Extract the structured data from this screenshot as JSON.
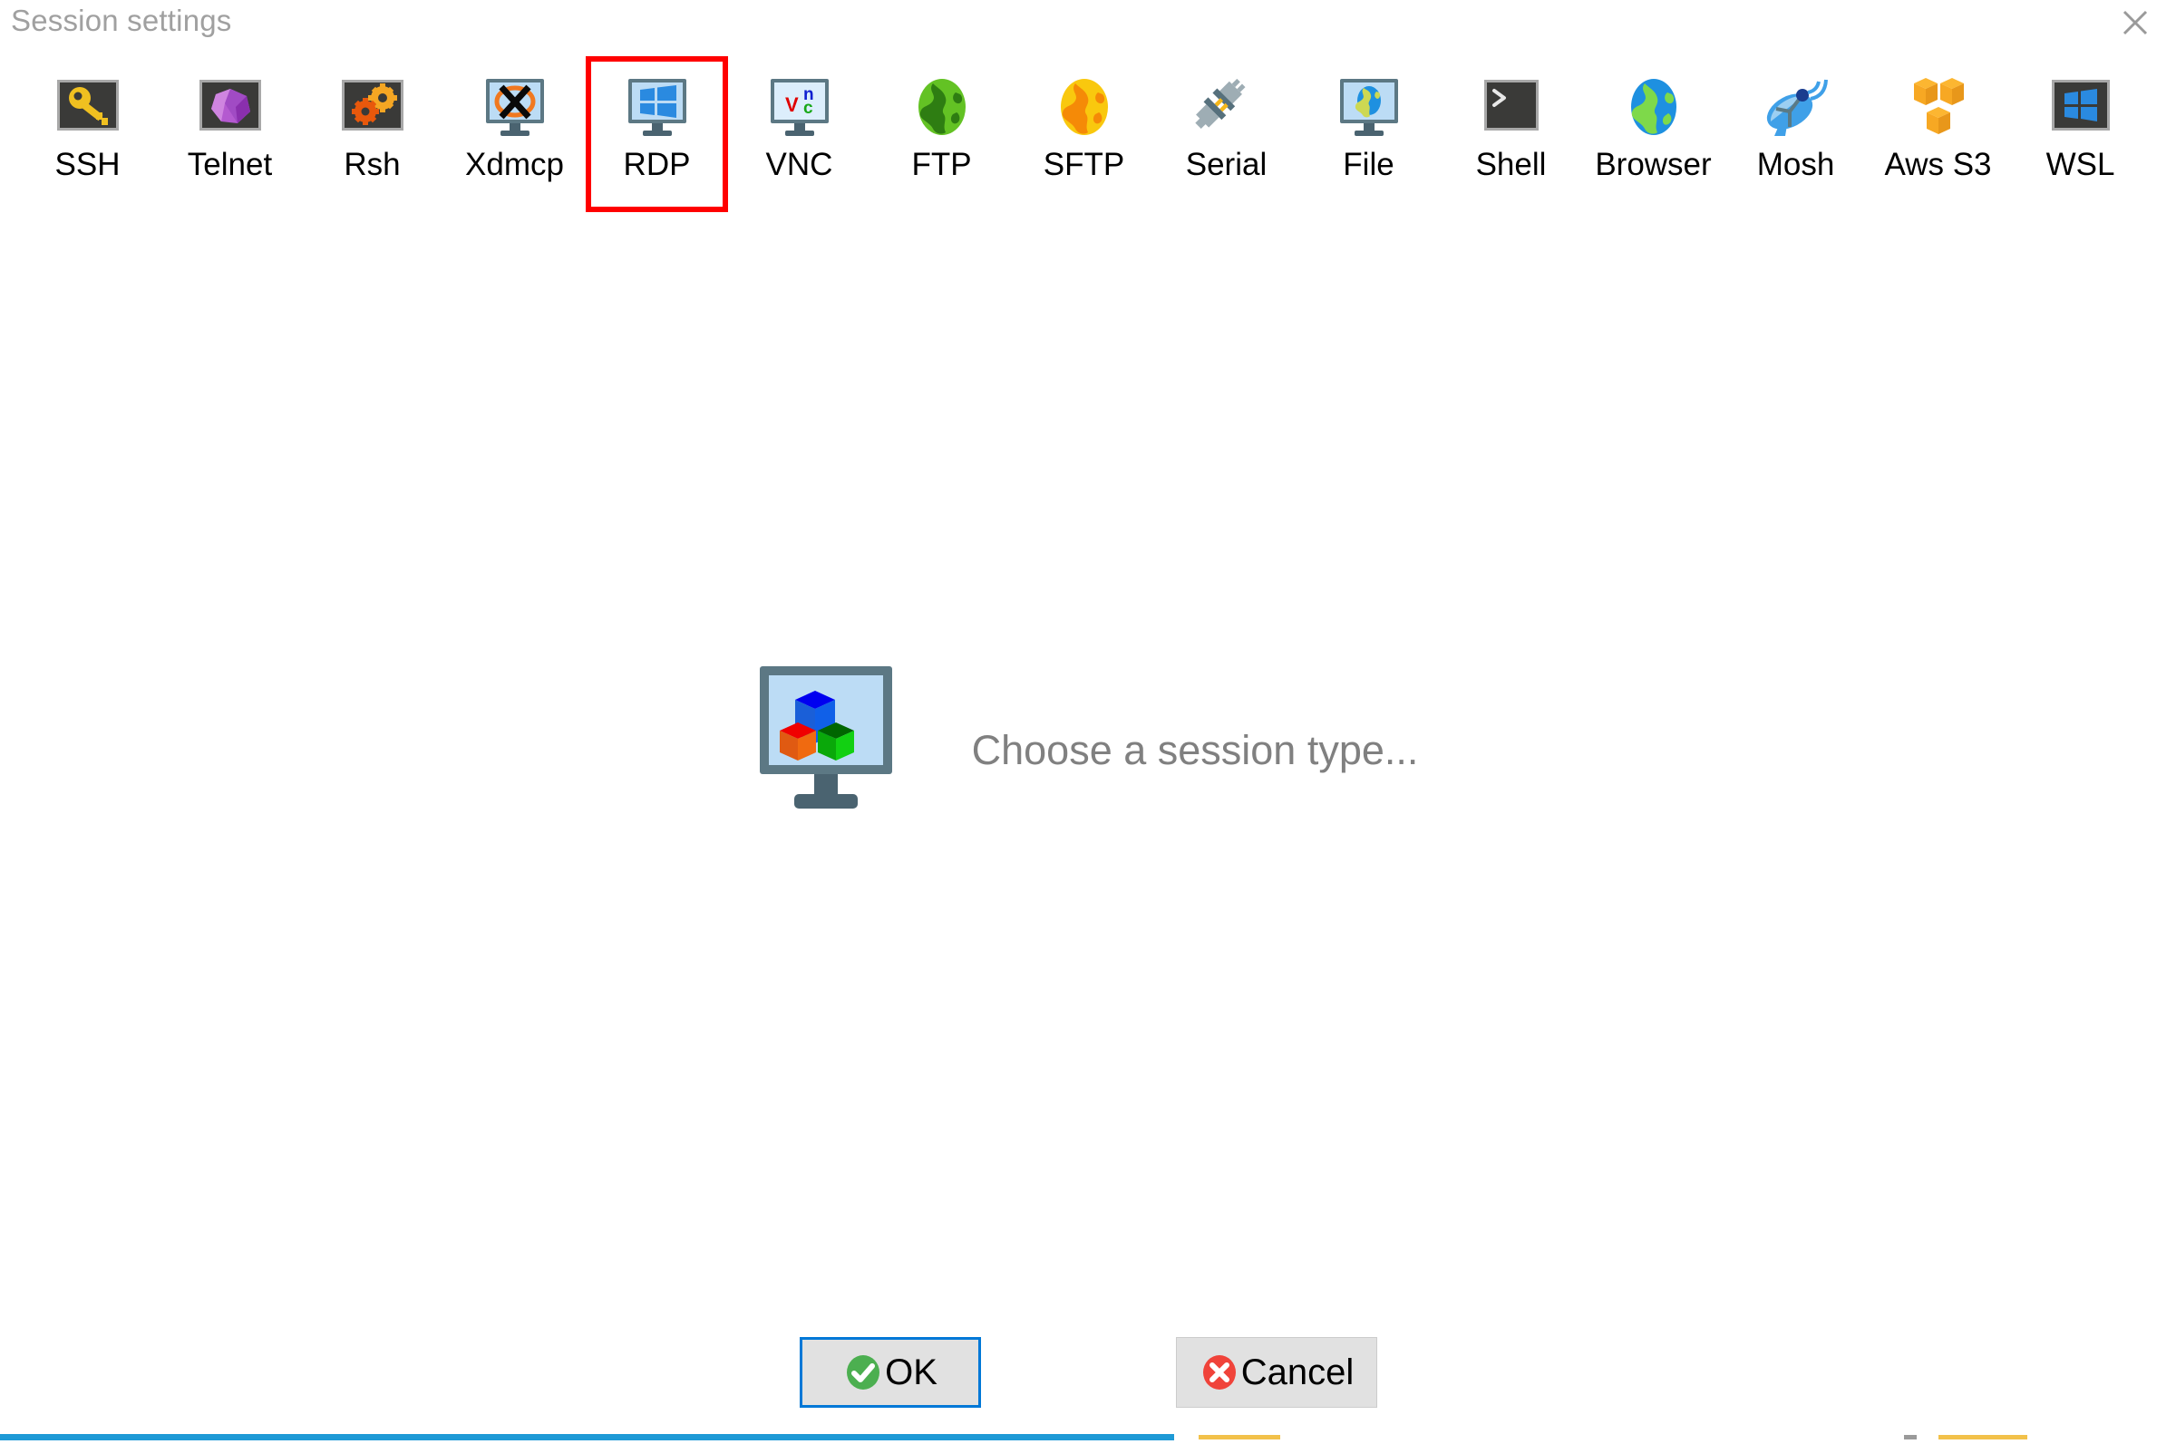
{
  "window": {
    "title": "Session settings",
    "close_icon": "close-icon",
    "title_color": "#a0a0a0"
  },
  "session_types": [
    {
      "id": "ssh",
      "label": "SSH",
      "icon": "key-icon",
      "selected": false
    },
    {
      "id": "telnet",
      "label": "Telnet",
      "icon": "gem-icon",
      "selected": false
    },
    {
      "id": "rsh",
      "label": "Rsh",
      "icon": "gears-icon",
      "selected": false
    },
    {
      "id": "xdmcp",
      "label": "Xdmcp",
      "icon": "x-monitor-icon",
      "selected": false
    },
    {
      "id": "rdp",
      "label": "RDP",
      "icon": "windows-monitor-icon",
      "selected": true
    },
    {
      "id": "vnc",
      "label": "VNC",
      "icon": "vnc-monitor-icon",
      "selected": false
    },
    {
      "id": "ftp",
      "label": "FTP",
      "icon": "green-globe-icon",
      "selected": false
    },
    {
      "id": "sftp",
      "label": "SFTP",
      "icon": "orange-globe-icon",
      "selected": false
    },
    {
      "id": "serial",
      "label": "Serial",
      "icon": "plug-icon",
      "selected": false
    },
    {
      "id": "file",
      "label": "File",
      "icon": "globe-monitor-icon",
      "selected": false
    },
    {
      "id": "shell",
      "label": "Shell",
      "icon": "terminal-prompt-icon",
      "selected": false
    },
    {
      "id": "browser",
      "label": "Browser",
      "icon": "blue-globe-icon",
      "selected": false
    },
    {
      "id": "mosh",
      "label": "Mosh",
      "icon": "satellite-dish-icon",
      "selected": false
    },
    {
      "id": "awss3",
      "label": "Aws S3",
      "icon": "aws-cubes-icon",
      "selected": false
    },
    {
      "id": "wsl",
      "label": "WSL",
      "icon": "windows-logo-icon",
      "selected": false
    }
  ],
  "selection_highlight_color": "#ff0000",
  "placeholder": {
    "text": "Choose a session type...",
    "icon": "cubes-monitor-icon",
    "text_color": "#808080"
  },
  "buttons": {
    "ok": {
      "label": "OK",
      "icon": "green-check-icon",
      "focus_color": "#0078d7"
    },
    "cancel": {
      "label": "Cancel",
      "icon": "red-x-icon"
    }
  }
}
